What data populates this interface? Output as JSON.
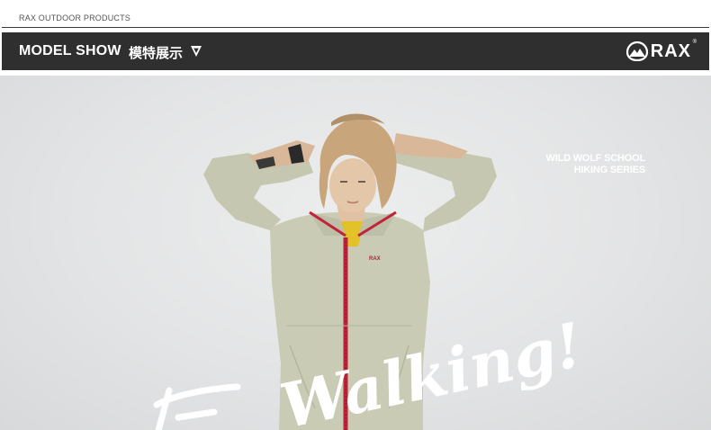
{
  "brand_line": "RAX OUTDOOR PRODUCTS",
  "header": {
    "title": "MODEL SHOW",
    "title_cn": "模特展示",
    "logo_text": "RAX",
    "logo_reg": "®"
  },
  "banner": {
    "series_line1": "WILD WOLF SCHOOL",
    "series_line2": "HIKING SERIES",
    "script_text": "Walking!"
  },
  "colors": {
    "header_bg": "#2f2f2f",
    "jacket": "#c9cbb4",
    "zipper": "#c0233a",
    "background": "#e4e5e6"
  },
  "icons": {
    "header_arrow": "triangle-down-icon",
    "logo": "rax-mountain-logo-icon"
  }
}
